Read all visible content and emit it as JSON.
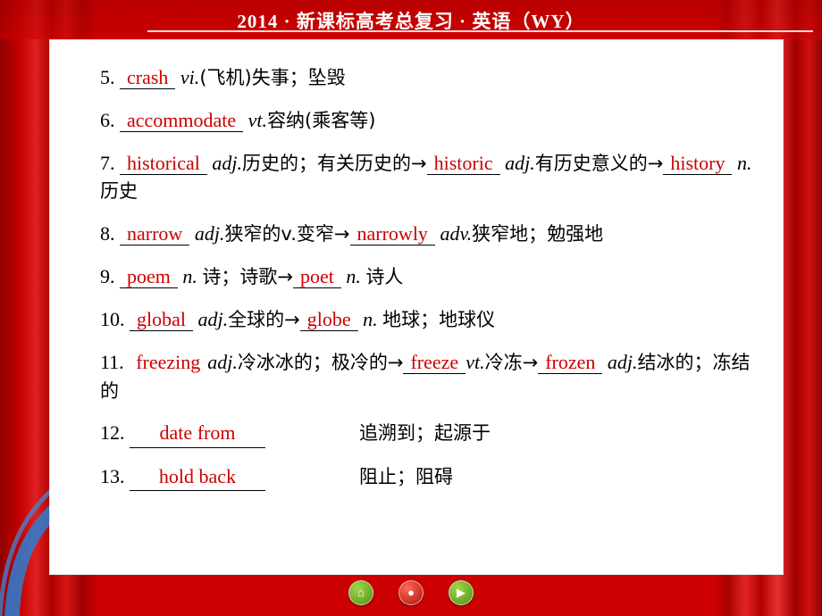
{
  "header": {
    "title": "2014 · 新课标高考总复习 · 英语（WY）"
  },
  "entries": [
    {
      "num": "5.",
      "blank": "crash",
      "pos": "vi.",
      "tail": "(飞机)失事；坠毁"
    },
    {
      "num": "6.",
      "blank": "accommodate",
      "pos": "vt.",
      "tail": "容纳(乘客等)"
    },
    {
      "num": "7.",
      "blank": "historical",
      "pos": "adj.",
      "mid": "历史的；有关历史的→",
      "blank2": "historic",
      "pos2": "adj.",
      "mid2": "有历史意义的→",
      "blank3": "history",
      "pos3": "n.",
      "tail": "历史"
    },
    {
      "num": "8.",
      "blank": "narrow",
      "pos": "adj.",
      "mid": "狭窄的v.变窄→",
      "blank2": "narrowly",
      "pos2": "adv.",
      "tail": "狭窄地；勉强地"
    },
    {
      "num": "9.",
      "blank": "poem",
      "pos": "n.",
      "mid": "诗；诗歌→",
      "blank2": "poet",
      "pos2": "n.",
      "tail": "诗人"
    },
    {
      "num": "10.",
      "blank": "global",
      "pos": "adj.",
      "mid": "全球的→",
      "blank2": "globe",
      "pos2": "n.",
      "tail": "地球；地球仪"
    },
    {
      "num": "11.",
      "blank": "freezing",
      "pos": "adj.",
      "mid": "冷冰冰的；极冷的→",
      "blank2": "freeze",
      "pos2": "vt.",
      "mid2": "冷冻→",
      "blank3": "frozen",
      "pos3": "adj.",
      "tail": "结冰的；冻结的"
    }
  ],
  "phrases": [
    {
      "num": "12.",
      "blank": "date from",
      "meaning": "追溯到；起源于"
    },
    {
      "num": "13.",
      "blank": "hold back",
      "meaning": "阻止；阻碍"
    }
  ],
  "nav": [
    {
      "name": "home-button",
      "glyph": "⌂"
    },
    {
      "name": "menu-button",
      "glyph": "●"
    },
    {
      "name": "next-button",
      "glyph": "▶"
    }
  ]
}
